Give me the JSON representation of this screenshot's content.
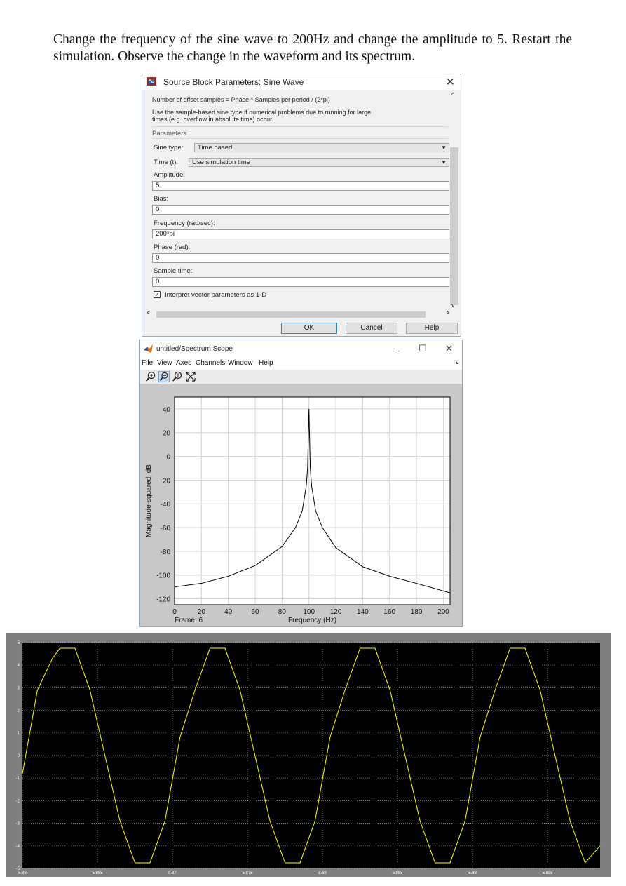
{
  "instructions": {
    "text": "Change the frequency of the sine wave to 200Hz and change the amplitude to 5. Restart the simulation. Observe the change in the waveform and its spectrum."
  },
  "dialog": {
    "title": "Source Block Parameters: Sine Wave",
    "desc1": "Number of offset samples = Phase * Samples per period / (2*pi)",
    "desc2a": "Use the sample-based sine type if numerical problems due to running for large",
    "desc2b": "times (e.g. overflow in absolute time) occur.",
    "section": "Parameters",
    "sine_type_label": "Sine type:",
    "sine_type_value": "Time based",
    "time_label": "Time (t):",
    "time_value": "Use simulation time",
    "amplitude_label": "Amplitude:",
    "amplitude_value": "5",
    "bias_label": "Bias:",
    "bias_value": "0",
    "frequency_label": "Frequency (rad/sec):",
    "frequency_value": "200*pi",
    "phase_label": "Phase (rad):",
    "phase_value": "0",
    "sample_time_label": "Sample time:",
    "sample_time_value": "0",
    "interpret_label": "Interpret vector parameters as 1-D",
    "interpret_checked": true,
    "ok": "OK",
    "cancel": "Cancel",
    "help": "Help",
    "scroll_left": "<",
    "scroll_right": ">",
    "scroll_up": "^",
    "scroll_down": "v",
    "close": "✕"
  },
  "scope": {
    "title": "untitled/Spectrum Scope",
    "minimize": "—",
    "maximize": "☐",
    "close": "✕",
    "menus": [
      "File",
      "View",
      "Axes",
      "Channels",
      "Window",
      "Help"
    ],
    "tools": [
      "zoom-in-icon",
      "zoom-x-icon",
      "zoom-y-icon",
      "autoscale-icon"
    ]
  },
  "chart_data": [
    {
      "type": "line",
      "ylabel": "Magnitude-squared, dB",
      "xlabel": "Frequency (Hz)",
      "frame_label": "Frame: 6",
      "xlim": [
        0,
        205
      ],
      "ylim": [
        -125,
        50
      ],
      "xticks": [
        0,
        20,
        40,
        60,
        80,
        100,
        120,
        140,
        160,
        180,
        200
      ],
      "yticks": [
        40,
        20,
        0,
        -20,
        -40,
        -60,
        -80,
        -100,
        -120
      ],
      "grid": true,
      "line_color": "#000000",
      "x": [
        0,
        20,
        40,
        60,
        80,
        90,
        95,
        98,
        99,
        100,
        101,
        102,
        105,
        110,
        120,
        140,
        160,
        180,
        205
      ],
      "y": [
        -110,
        -107,
        -101,
        -92,
        -76,
        -60,
        -46,
        -25,
        -10,
        40,
        -10,
        -25,
        -46,
        -60,
        -77,
        -93,
        -101,
        -107,
        -115
      ]
    },
    {
      "type": "line",
      "xlim": [
        5.86,
        5.8985
      ],
      "ylim": [
        -5,
        5
      ],
      "xticks": [
        5.86,
        5.865,
        5.87,
        5.875,
        5.88,
        5.885,
        5.89,
        5.895
      ],
      "xtick_labels": [
        "5.86",
        "5.865",
        "5.87",
        "5.875",
        "5.88",
        "5.885",
        "5.89",
        "5.895"
      ],
      "yticks": [
        5,
        4,
        3,
        2,
        1,
        0,
        -1,
        -2,
        -3,
        -4,
        -5
      ],
      "grid": true,
      "line_color": "#ffff00",
      "x": [
        5.86,
        5.861,
        5.862,
        5.8625,
        5.8635,
        5.8645,
        5.8655,
        5.8665,
        5.8675,
        5.8685,
        5.8695,
        5.8705,
        5.8715,
        5.8725,
        5.8735,
        5.8745,
        5.8755,
        5.8765,
        5.8775,
        5.8785,
        5.8795,
        5.8805,
        5.8815,
        5.8825,
        5.8835,
        5.8845,
        5.8855,
        5.8865,
        5.8875,
        5.8885,
        5.8895,
        5.8905,
        5.8915,
        5.8925,
        5.8935,
        5.8945,
        5.8955,
        5.8965,
        5.8975,
        5.8985
      ],
      "y": [
        -0.8,
        2.9,
        4.3,
        4.75,
        4.75,
        2.9,
        0,
        -2.9,
        -4.75,
        -4.75,
        -2.9,
        0.8,
        2.9,
        4.75,
        4.75,
        2.9,
        0,
        -2.9,
        -4.75,
        -4.75,
        -2.9,
        0.8,
        2.9,
        4.75,
        4.75,
        2.9,
        0,
        -2.9,
        -4.75,
        -4.75,
        -2.9,
        0.8,
        2.9,
        4.75,
        4.75,
        2.9,
        0,
        -2.9,
        -4.75,
        -4.0
      ]
    }
  ]
}
